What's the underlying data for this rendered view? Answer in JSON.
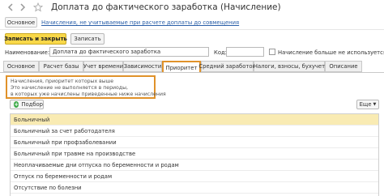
{
  "window": {
    "title": "Доплата до фактического заработка (Начисление)"
  },
  "navigation": {
    "main_label": "Основное",
    "link_label": "Начисления, не учитываемые при расчете доплаты до совмещения"
  },
  "toolbar": {
    "save_close_label": "Записать и закрыть",
    "save_label": "Записать"
  },
  "form": {
    "name_label": "Наименование:",
    "name_value": "Доплата до фактического заработка",
    "code_label": "Код:",
    "unused_label": "Начисление больше не используется"
  },
  "tabs": [
    {
      "label": "Основное"
    },
    {
      "label": "Расчет базы"
    },
    {
      "label": "Учет времени"
    },
    {
      "label": "Зависимости"
    },
    {
      "label": "Приоритет"
    },
    {
      "label": "Средний заработок"
    },
    {
      "label": "Налоги, взносы, бухучет"
    },
    {
      "label": "Описание"
    }
  ],
  "info": {
    "line1": "Начисления, приоритет которых выше",
    "line2": "Это начисление не выполняется в периоды,",
    "line3": "в которых уже начислены приведенные ниже начисления"
  },
  "list_toolbar": {
    "pick_label": "Подбор",
    "more_label": "Еще"
  },
  "list": {
    "rows": [
      "Больничный",
      "Больничный за счет работодателя",
      "Больничный при профзаболевании",
      "Больничный при травме на производстве",
      "Неоплачиваемые дни отпуска по беременности и родам",
      "Отпуск по беременности и родам",
      "Отсутствие по болезни"
    ]
  }
}
